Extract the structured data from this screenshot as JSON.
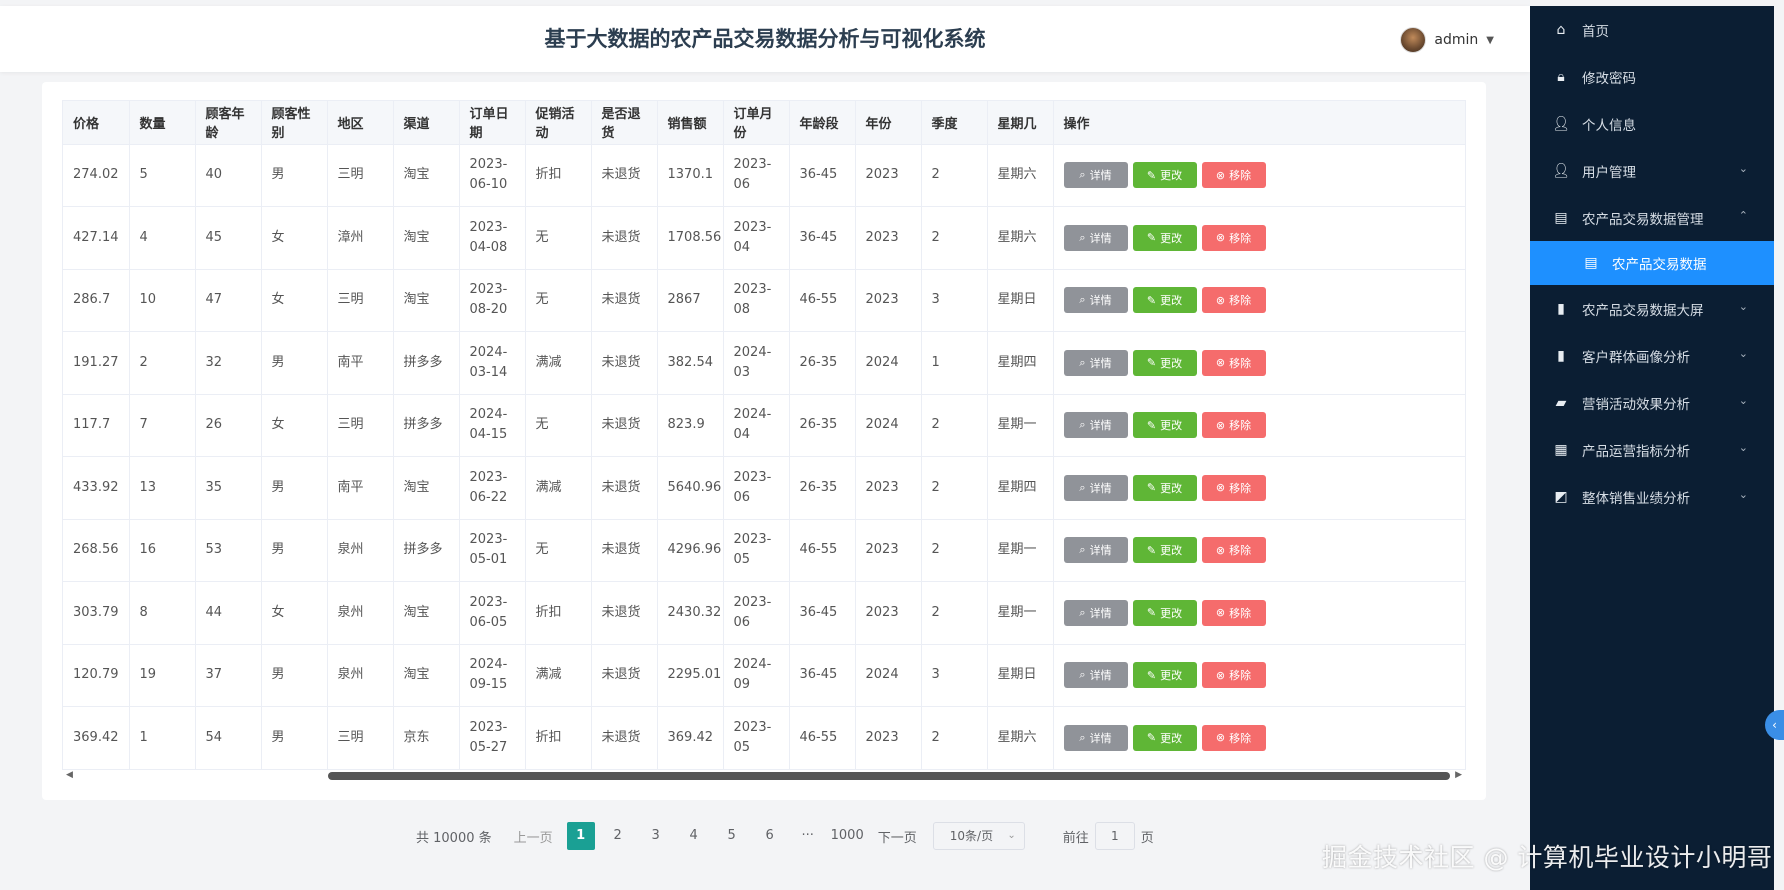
{
  "header": {
    "title": "基于大数据的农产品交易数据分析与可视化系统",
    "username": "admin"
  },
  "table": {
    "columns": [
      "价格",
      "数量",
      "顾客年龄",
      "顾客性别",
      "地区",
      "渠道",
      "订单日期",
      "促销活动",
      "是否退货",
      "销售额",
      "订单月份",
      "年龄段",
      "年份",
      "季度",
      "星期几",
      "操作"
    ],
    "rows": [
      [
        "274.02",
        "5",
        "40",
        "男",
        "三明",
        "淘宝",
        "2023-06-10",
        "折扣",
        "未退货",
        "1370.1",
        "2023-06",
        "36-45",
        "2023",
        "2",
        "星期六"
      ],
      [
        "427.14",
        "4",
        "45",
        "女",
        "漳州",
        "淘宝",
        "2023-04-08",
        "无",
        "未退货",
        "1708.56",
        "2023-04",
        "36-45",
        "2023",
        "2",
        "星期六"
      ],
      [
        "286.7",
        "10",
        "47",
        "女",
        "三明",
        "淘宝",
        "2023-08-20",
        "无",
        "未退货",
        "2867",
        "2023-08",
        "46-55",
        "2023",
        "3",
        "星期日"
      ],
      [
        "191.27",
        "2",
        "32",
        "男",
        "南平",
        "拼多多",
        "2024-03-14",
        "满减",
        "未退货",
        "382.54",
        "2024-03",
        "26-35",
        "2024",
        "1",
        "星期四"
      ],
      [
        "117.7",
        "7",
        "26",
        "女",
        "三明",
        "拼多多",
        "2024-04-15",
        "无",
        "未退货",
        "823.9",
        "2024-04",
        "26-35",
        "2024",
        "2",
        "星期一"
      ],
      [
        "433.92",
        "13",
        "35",
        "男",
        "南平",
        "淘宝",
        "2023-06-22",
        "满减",
        "未退货",
        "5640.96",
        "2023-06",
        "26-35",
        "2023",
        "2",
        "星期四"
      ],
      [
        "268.56",
        "16",
        "53",
        "男",
        "泉州",
        "拼多多",
        "2023-05-01",
        "无",
        "未退货",
        "4296.96",
        "2023-05",
        "46-55",
        "2023",
        "2",
        "星期一"
      ],
      [
        "303.79",
        "8",
        "44",
        "女",
        "泉州",
        "淘宝",
        "2023-06-05",
        "折扣",
        "未退货",
        "2430.32",
        "2023-06",
        "36-45",
        "2023",
        "2",
        "星期一"
      ],
      [
        "120.79",
        "19",
        "37",
        "男",
        "泉州",
        "淘宝",
        "2024-09-15",
        "满减",
        "未退货",
        "2295.01",
        "2024-09",
        "36-45",
        "2024",
        "3",
        "星期日"
      ],
      [
        "369.42",
        "1",
        "54",
        "男",
        "三明",
        "京东",
        "2023-05-27",
        "折扣",
        "未退货",
        "369.42",
        "2023-05",
        "46-55",
        "2023",
        "2",
        "星期六"
      ]
    ],
    "actions": {
      "view": "详情",
      "edit": "更改",
      "delete": "移除"
    }
  },
  "pager": {
    "total": "共 10000 条",
    "prev": "上一页",
    "pages": [
      "1",
      "2",
      "3",
      "4",
      "5",
      "6",
      "···",
      "1000"
    ],
    "active": "1",
    "next": "下一页",
    "page_size": "10条/页",
    "goto_prefix": "前往",
    "goto_value": "1",
    "goto_suffix": "页"
  },
  "sidebar": {
    "items": [
      {
        "label": "首页",
        "icon": "home-icon",
        "glyph": "⌂",
        "chevron": ""
      },
      {
        "label": "修改密码",
        "icon": "lock-icon",
        "glyph": "🔒︎",
        "chevron": ""
      },
      {
        "label": "个人信息",
        "icon": "user-icon",
        "glyph": "👤︎",
        "chevron": ""
      },
      {
        "label": "用户管理",
        "icon": "user-icon",
        "glyph": "👤︎",
        "chevron": "⌄"
      },
      {
        "label": "农产品交易数据管理",
        "icon": "clipboard-icon",
        "glyph": "▤",
        "chevron": "⌃"
      },
      {
        "label": "农产品交易数据",
        "icon": "clipboard-icon",
        "glyph": "▤",
        "chevron": "",
        "sub": true
      },
      {
        "label": "农产品交易数据大屏",
        "icon": "bar-chart-icon",
        "glyph": "▮",
        "chevron": "⌄"
      },
      {
        "label": "客户群体画像分析",
        "icon": "bar-chart-icon",
        "glyph": "▮",
        "chevron": "⌄"
      },
      {
        "label": "营销活动效果分析",
        "icon": "bag-icon",
        "glyph": "▰",
        "chevron": "⌄"
      },
      {
        "label": "产品运营指标分析",
        "icon": "grid-icon",
        "glyph": "▦",
        "chevron": "⌄"
      },
      {
        "label": "整体销售业绩分析",
        "icon": "line-chart-icon",
        "glyph": "◩",
        "chevron": "⌄"
      }
    ]
  },
  "watermark": "掘金技术社区 @ 计算机毕业设计小明哥",
  "colors": {
    "sidebar": "#0b1e33",
    "active": "#1e90ff",
    "edit": "#5fb636",
    "delete": "#f56c6c",
    "view": "#909399",
    "pager_active": "#1aa094"
  }
}
